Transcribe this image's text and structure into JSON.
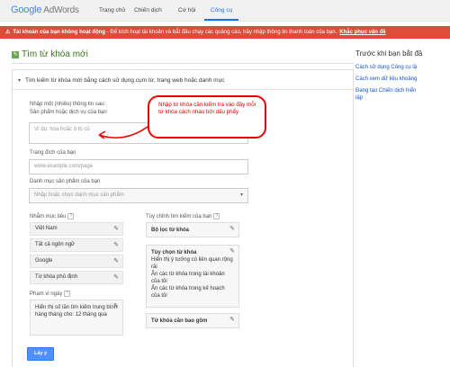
{
  "header": {
    "logo_google": "Google",
    "logo_product": "AdWords",
    "nav": [
      "Trang chủ",
      "Chiến dịch",
      "Cơ hội",
      "Công cụ"
    ]
  },
  "alert": {
    "icon": "warning-icon",
    "title": "Tài khoản của bạn không hoạt động",
    "message": " - Để kích hoạt tài khoản và bắt đầu chạy các quảng cáo, hãy nhập thông tin thanh toán của bạn.",
    "link": "Khắc phục vấn đề"
  },
  "page": {
    "title": "Tìm từ khóa mới",
    "section_title": "Tìm kiếm từ khóa mới bằng cách sử dụng cụm từ, trang web hoặc danh mục"
  },
  "form": {
    "keywords_label_1": "Nhập một (nhiều) thông tin sau:",
    "keywords_label_2": "Sản phẩm hoặc dịch vụ của bạn",
    "keywords_placeholder": "Ví dụ: hoa hoặc ô tô cũ",
    "landing_label": "Trang đích của bạn",
    "landing_placeholder": "www.example.com/page",
    "category_label": "Danh mục sản phẩm của bạn",
    "category_placeholder": "Nhập hoặc chọn danh mục sản phẩm",
    "targeting_label": "Nhắm mục tiêu",
    "targeting_items": [
      "Việt Nam",
      "Tất cả ngôn ngữ",
      "Google",
      "Từ khóa phủ định"
    ],
    "date_label": "Phạm vi ngày",
    "date_text": "Hiển thị số lần tìm kiếm trung bình hàng tháng cho: 12 tháng qua",
    "customize_label": "Tùy chỉnh tìm kiếm của bạn",
    "filter_title": "Bộ lọc từ khóa",
    "options_title": "Tùy chọn từ khóa",
    "options_lines": [
      "Hiển thị ý tưởng có liên quan rộng rãi",
      "Ẩn các từ khóa trong tài khoản của tôi",
      "Ẩn các từ khóa trong kế hoạch của tôi"
    ],
    "include_title": "Từ khóa cần bao gồm",
    "submit_label": "Lấy ý tưởng"
  },
  "sidebar": {
    "title": "Trước khi bạn bắt đầ",
    "links": [
      "Cách sử dụng Công cụ lậ",
      "Cách xem dữ liệu khoảng",
      "Đang tạo Chiến dịch hiển",
      "lập"
    ]
  },
  "annotation": {
    "text": "Nhập từ khóa cần kiểm tra vào đây mỗi từ khóa cách nhau bởi dấu phẩy",
    "color": "#dd0000"
  },
  "colors": {
    "alert_bg": "#dd4b39",
    "title_green": "#38761d",
    "button_blue": "#4d90fe",
    "link_blue": "#1155cc"
  }
}
